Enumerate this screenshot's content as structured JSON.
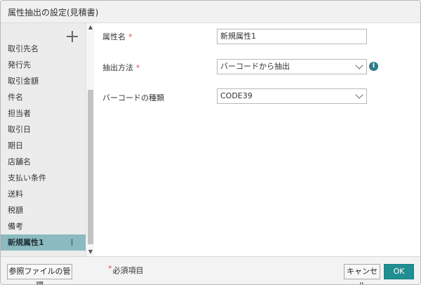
{
  "dialog": {
    "title": "属性抽出の設定(見積書)"
  },
  "sidebar": {
    "add_icon": "plus-icon",
    "items": [
      {
        "label": "取引先名"
      },
      {
        "label": "発行先"
      },
      {
        "label": "取引金額"
      },
      {
        "label": "件名"
      },
      {
        "label": "担当者"
      },
      {
        "label": "取引日"
      },
      {
        "label": "期日"
      },
      {
        "label": "店舗名"
      },
      {
        "label": "支払い条件"
      },
      {
        "label": "送料"
      },
      {
        "label": "税額"
      },
      {
        "label": "備考"
      },
      {
        "label": "新規属性1",
        "selected": true,
        "menu": "⋮"
      }
    ]
  },
  "scrollbar": {
    "up": "▲",
    "down": "▼"
  },
  "form": {
    "attr_name": {
      "label": "属性名",
      "required_mark": "*",
      "value": "新規属性1"
    },
    "method": {
      "label": "抽出方法",
      "required_mark": "*",
      "value": "バーコードから抽出",
      "info_icon": "info-icon",
      "info_glyph": "i"
    },
    "barcode": {
      "label": "バーコードの種類",
      "value": "CODE39"
    }
  },
  "footer": {
    "manage_label": "参照ファイルの管理",
    "required_star": "*",
    "required_label": "必須項目",
    "cancel_label": "キャンセル",
    "ok_label": "OK"
  },
  "colors": {
    "accent": "#1f8f92",
    "selected_row": "#8bbac0",
    "required": "#d9534f"
  }
}
